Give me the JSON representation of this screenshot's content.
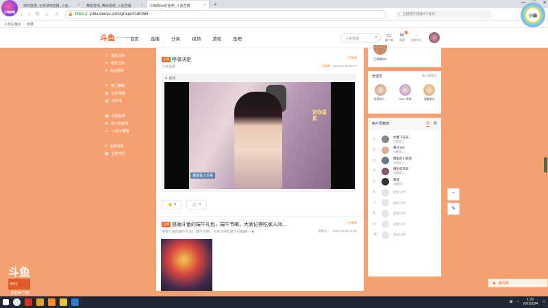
{
  "browser": {
    "tabs": [
      {
        "label": "游戏直播_全部游戏直播_斗鱼..."
      },
      {
        "label": "舞蹈直播_舞蹈视频_斗鱼直播"
      },
      {
        "label": "江梅阁bfs的鱼吧_斗鱼直播"
      }
    ],
    "logo_label": "江梅拖鞋",
    "url_scheme": "https://",
    "url_path": "yuba.douyu.com/group/3180356",
    "search_placeholder": "在搜狗中搜索4个条件",
    "bookmarks": [
      {
        "label": "人找小喵小"
      },
      {
        "label": "动漫"
      }
    ],
    "corner_badge": "小猫",
    "win": {
      "min": "—",
      "max": "□",
      "close": "✕"
    }
  },
  "site": {
    "brand": "斗鱼",
    "brand_sub": "DOUYU.COM",
    "nav": [
      "首页",
      "直播",
      "分类",
      "视频",
      "游戏",
      "鱼吧"
    ],
    "search_placeholder": "斗鱼直播",
    "header_icons": [
      {
        "label": "客户端",
        "icon": "monitor-icon"
      },
      {
        "label": "消息",
        "icon": "bell-icon",
        "badge": "2"
      },
      {
        "label": "创作中心",
        "icon": "bulb-icon"
      }
    ]
  },
  "sidebar": {
    "items": [
      {
        "label": "我关注的",
        "icon": "heart-icon"
      },
      {
        "label": "我发过的",
        "icon": "pencil-icon"
      },
      {
        "label": "我点赞的",
        "icon": "like-icon"
      },
      {
        "label": "热门推荐",
        "icon": "fire-icon"
      },
      {
        "label": "社区热榜",
        "icon": "chart-icon"
      },
      {
        "label": "排行榜",
        "icon": "rank-icon"
      },
      {
        "label": "全部鱼吧",
        "icon": "grid-icon"
      },
      {
        "label": "加入的鱼吧",
        "icon": "plus-icon"
      },
      {
        "label": "人找小喵喵",
        "icon": "user-icon"
      },
      {
        "label": "全部话题",
        "icon": "hash-icon"
      },
      {
        "label": "全部专栏",
        "icon": "book-icon"
      }
    ]
  },
  "posts": [
    {
      "tag": "主播",
      "title": "呼吸决定",
      "subtitle": "分享视频",
      "group": "江梅阁",
      "datetime": "2022-01-18 09:17",
      "video_label": "视频",
      "caption": "番茄看了又看",
      "overlay_text": "送你星星",
      "likes": "4",
      "comments": "0"
    },
    {
      "tag": "主播",
      "title": "感谢斗鱼的端午礼包，端午节嘛，大家记得吃家人间...",
      "subtitle": "感谢斗鱼的端午礼包，端午节嘛，大家记得吃家人间粽粽～",
      "group": "江梅阁",
      "author": "斯格公...",
      "datetime": "2021-06-08 15:48"
    }
  ],
  "right": {
    "top_user": "江梅阁bfs",
    "managers_title": "管理员",
    "managers_more": "加入管理员",
    "managers": [
      {
        "name": "鱼满的小...",
        "color": "#c98f6a"
      },
      {
        "name": "Shirn 咪咪",
        "color": "#b08ac8"
      },
      {
        "name": "溜着鲁米",
        "color": "#d8a24a"
      }
    ],
    "contrib_title": "用户贡献榜",
    "contrib_tabs": [
      "周",
      "月"
    ],
    "contrib": [
      {
        "rank": "1",
        "name": "亦譬飞升前...",
        "score": "贡献值 4",
        "color": "#888"
      },
      {
        "rank": "2",
        "name": "蝉过190",
        "score": "贡献值 4",
        "color": "#e0b090"
      },
      {
        "rank": "3",
        "name": "鲤鱼的小歌迷",
        "score": "贡献值 3",
        "color": "#6a7a8a"
      },
      {
        "rank": "4",
        "name": "鲤鱼追风日",
        "score": "贡献值 3",
        "color": "#8a5a6a"
      },
      {
        "rank": "5",
        "name": "路遥",
        "score": "贡献值 2",
        "color": "#333"
      },
      {
        "rank": "6",
        "name": "虚位以待",
        "score": ""
      },
      {
        "rank": "7",
        "name": "虚位以待",
        "score": ""
      },
      {
        "rank": "8",
        "name": "虚位以待",
        "score": ""
      },
      {
        "rank": "9",
        "name": "虚位以待",
        "score": ""
      },
      {
        "rank": "10",
        "name": "虚位以待",
        "score": ""
      }
    ]
  },
  "overlay": {
    "watermark": "斗鱼",
    "watermark_sub": "鱼吧号",
    "room_id": "4594756",
    "yuchi_label": "鱼丸库"
  },
  "taskbar": {
    "time": "1:23",
    "date": "2022/3/24"
  }
}
